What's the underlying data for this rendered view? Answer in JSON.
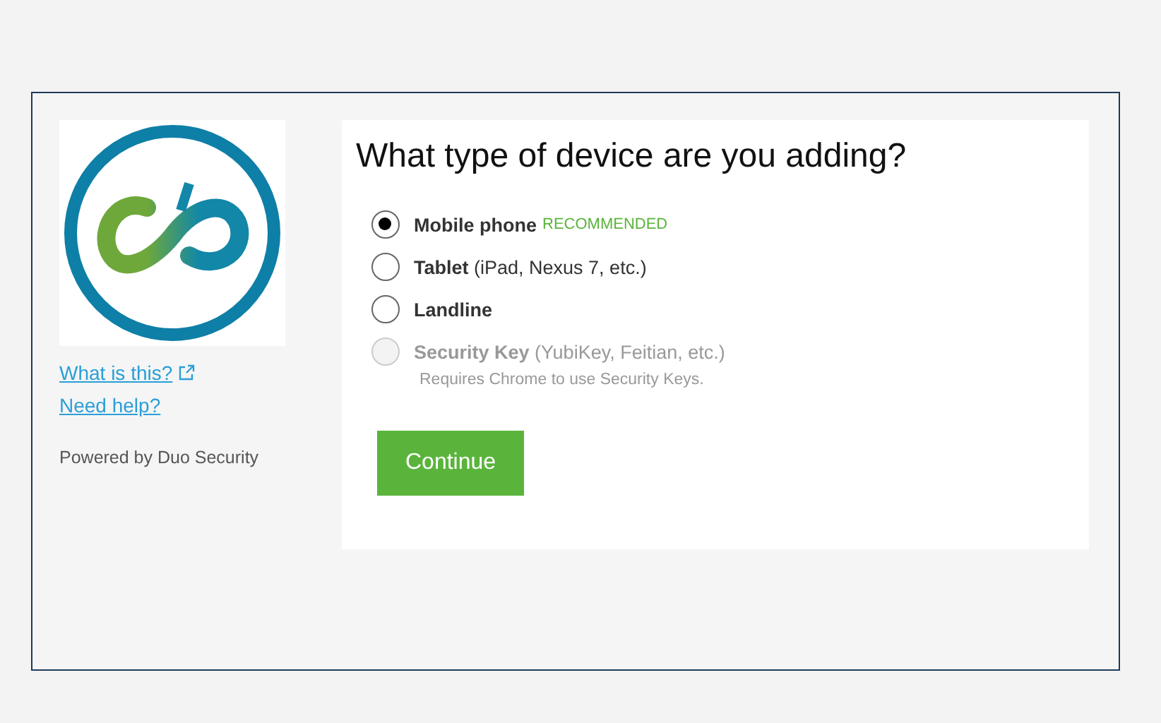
{
  "sidebar": {
    "links": [
      {
        "text": "What is this?",
        "external": true
      },
      {
        "text": "Need help?",
        "external": false
      }
    ],
    "powered_by": "Powered by Duo Security"
  },
  "form": {
    "title": "What type of device are you adding?",
    "options": [
      {
        "label": "Mobile phone",
        "badge": "RECOMMENDED",
        "selected": true,
        "disabled": false
      },
      {
        "label": "Tablet",
        "detail": "(iPad, Nexus 7, etc.)",
        "selected": false,
        "disabled": false
      },
      {
        "label": "Landline",
        "selected": false,
        "disabled": false
      },
      {
        "label": "Security Key",
        "detail": "(YubiKey, Feitian, etc.)",
        "note": "Requires Chrome to use Security Keys.",
        "selected": false,
        "disabled": true
      }
    ],
    "button": "Continue"
  }
}
